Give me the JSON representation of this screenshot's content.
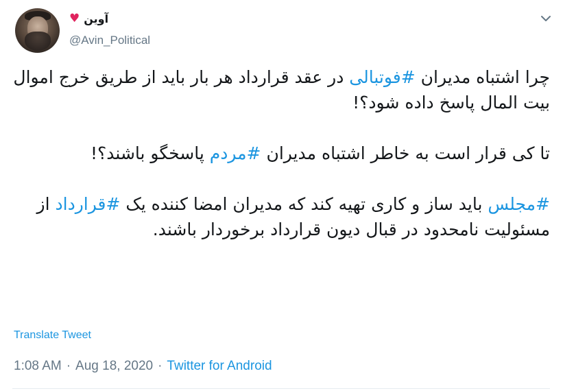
{
  "user": {
    "display_name": "آوین",
    "handle": "@Avin_Political",
    "name_emoji_icon": "heart-icon"
  },
  "tweet": {
    "para1": {
      "part1": "چرا اشتباه مدیران ",
      "hashtag1": "#فوتبالی",
      "part2": " در عقد قرارداد  هر بار باید از طریق خرج اموال بیت المال پاسخ داده شود؟!"
    },
    "para2": {
      "part1": "تا کی قرار است به خاطر اشتباه مدیران ",
      "hashtag1": "#مردم",
      "part2": " پاسخگو باشند؟!"
    },
    "para3": {
      "hashtag1": "#مجلس",
      "part1": " باید ساز و کاری تهیه کند که مدیران امضا کننده یک ",
      "hashtag2": "#قرارداد",
      "part2": " از مسئولیت نامحدود در قبال دیون قرارداد برخوردار باشند."
    }
  },
  "translate_label": "Translate Tweet",
  "meta": {
    "time": "1:08 AM",
    "separator": "·",
    "date": "Aug 18, 2020",
    "source": "Twitter for Android"
  },
  "colors": {
    "link": "#1b95e0",
    "secondary_text": "#657786",
    "heart": "#e0245e"
  }
}
